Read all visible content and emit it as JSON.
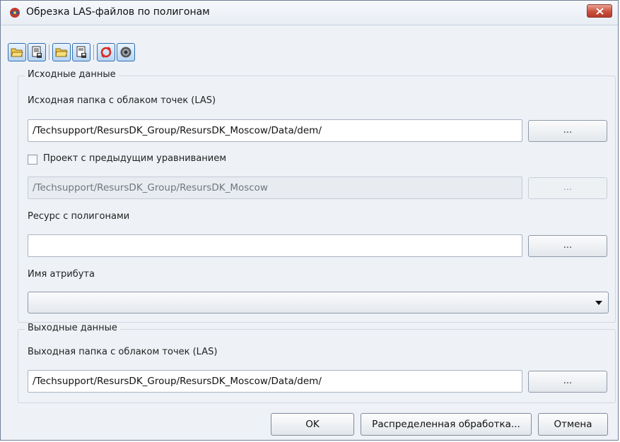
{
  "window": {
    "title": "Обрезка LAS-файлов по полигонам"
  },
  "toolbar": {
    "buttons": [
      {
        "icon": "open-folder-icon"
      },
      {
        "icon": "save-settings-icon"
      },
      {
        "icon": "folder-icon"
      },
      {
        "icon": "save-icon"
      },
      {
        "icon": "refresh-icon"
      },
      {
        "icon": "reset-icon"
      }
    ]
  },
  "input_group": {
    "title": "Исходные данные",
    "las_folder_label": "Исходная папка с облаком точек (LAS)",
    "las_folder_value": "/Techsupport/ResursDK_Group/ResursDK_Moscow/Data/dem/",
    "browse_label": "...",
    "prev_adjustment_checkbox_label": "Проект с предыдущим уравниванием",
    "prev_adjustment_checked": false,
    "prev_adjustment_value": "/Techsupport/ResursDK_Group/ResursDK_Moscow",
    "polygon_resource_label": "Ресурс с полигонами",
    "polygon_resource_value": "",
    "attribute_name_label": "Имя атрибута",
    "attribute_name_value": ""
  },
  "output_group": {
    "title": "Выходные данные",
    "out_folder_label": "Выходная папка с облаком точек (LAS)",
    "out_folder_value": "/Techsupport/ResursDK_Group/ResursDK_Moscow/Data/dem/",
    "browse_label": "..."
  },
  "footer": {
    "ok_label": "OK",
    "distributed_label": "Распределенная обработка...",
    "cancel_label": "Отмена"
  },
  "colors": {
    "window_bg": "#eef1f6",
    "close_red": "#c9503d",
    "toolbar_accent": "#2f6fb0"
  }
}
